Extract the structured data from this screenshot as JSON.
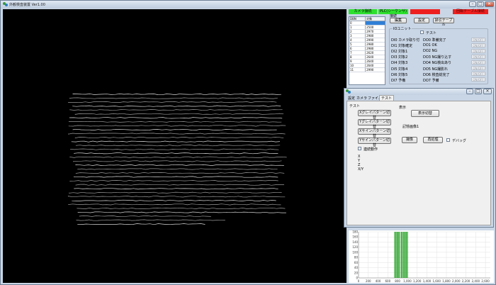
{
  "window": {
    "title": "外観検査装置 Ver1.00"
  },
  "status": {
    "camera": "カメラ接続",
    "plc": "PLC(シーケンサ)接続",
    "red1": "",
    "red2": "回転テーブル接続"
  },
  "table": {
    "col1": "DBN",
    "col2": "対象",
    "rows": [
      [
        "0",
        ""
      ],
      [
        "1",
        "2500"
      ],
      [
        "2",
        "2970"
      ],
      [
        "3",
        "2980"
      ],
      [
        "4",
        "2990"
      ],
      [
        "5",
        "2980"
      ],
      [
        "6",
        "2980"
      ],
      [
        "7",
        "2620"
      ],
      [
        "8",
        "2640"
      ],
      [
        "9",
        "2640"
      ],
      [
        "10",
        "2640"
      ],
      [
        "11",
        "2990"
      ]
    ],
    "selected_row": 0
  },
  "buttons": {
    "edit": "編集",
    "settings": "設定",
    "table": "掃引テーブル"
  },
  "io": {
    "title": "IOユニット",
    "test_label": "テスト",
    "inputs": [
      "DI0 カメラ取り付",
      "DI1 対象確定",
      "DI2 対象1",
      "DI3 対象2",
      "DI4 対象3",
      "DI5 対象4",
      "DI6 対象5",
      "DI7 予備"
    ],
    "outputs": [
      "DO0 準備完了",
      "DO1 OK",
      "DO2 NG",
      "DO3 NG撮り込す",
      "DO4 NG検出あり",
      "DO5 NG撮影れ",
      "DO6 検査総完了",
      "DO7 予備"
    ],
    "onoff": "ON/OFF"
  },
  "sub": {
    "tabs": [
      "設定",
      "カメラ",
      "ファイル",
      "テスト"
    ],
    "active_tab": 3,
    "test_group": "テスト",
    "display_group": "表示",
    "pattern_buttons": [
      "Xグレイパターン切替",
      "Yグレイパターン切替",
      "Xサインパターン切替",
      "Yサインパターン切替"
    ],
    "display_switch": "表示切替",
    "memory_image": "記憶画像1",
    "capture": "撮像",
    "reprocess": "再処理",
    "debug": "デバッグ",
    "continuous": "連続動作",
    "coords": [
      "X",
      "Y",
      "Z",
      "X/Y"
    ]
  },
  "histogram": {
    "y_ticks": [
      "180",
      "160",
      "140",
      "120",
      "100",
      "80",
      "60",
      "40",
      "20",
      "0"
    ],
    "x_ticks": [
      "0",
      "200",
      "400",
      "600",
      "800",
      "1,000",
      "1,200",
      "1,400",
      "1,600",
      "1,800",
      "2,000",
      "2,200",
      "2,400",
      "2,600"
    ]
  },
  "chart_data": {
    "type": "bar",
    "xlim": [
      0,
      2700
    ],
    "ylim": [
      0,
      180
    ],
    "bars": [
      {
        "x": 740,
        "value": 180
      },
      {
        "x": 765,
        "value": 180
      },
      {
        "x": 790,
        "value": 180
      },
      {
        "x": 815,
        "value": 180
      },
      {
        "x": 840,
        "value": 180
      },
      {
        "x": 875,
        "value": 180
      },
      {
        "x": 900,
        "value": 180
      },
      {
        "x": 925,
        "value": 180
      },
      {
        "x": 950,
        "value": 180
      },
      {
        "x": 975,
        "value": 180
      },
      {
        "x": 1000,
        "value": 180
      }
    ],
    "color": "#1e9e1e"
  }
}
